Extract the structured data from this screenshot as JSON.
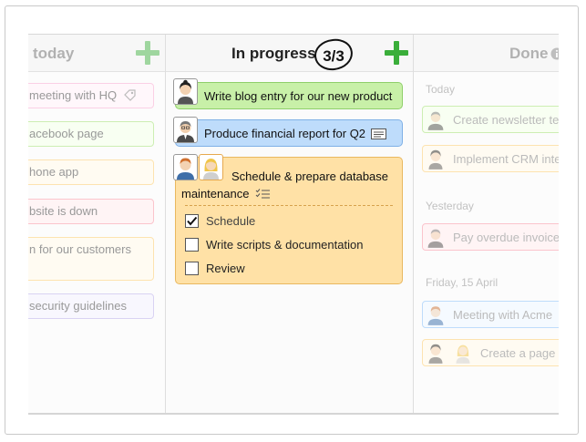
{
  "columns": {
    "left": {
      "title": "today",
      "cards": [
        {
          "text": "meeting with HQ",
          "color": "#fbd0e5"
        },
        {
          "text": "acebook page",
          "color": "#cdeeb3"
        },
        {
          "text": "hone app",
          "color": "#fde3b0"
        },
        {
          "text": "bsite is down",
          "color": "#fbc4cc"
        },
        {
          "text": "n for our customers",
          "color": "#fde3b0"
        },
        {
          "text": "security guidelines",
          "color": "#d9d3f3"
        }
      ]
    },
    "middle": {
      "title": "In progress",
      "count": "3/3",
      "cards": [
        {
          "text": "Write blog entry for our new product",
          "color": "#c8f0a8"
        },
        {
          "text": "Produce financial report for Q2",
          "color": "#bedcfb"
        },
        {
          "text_line1": "Schedule & prepare database",
          "text_line2": "maintenance",
          "color": "#ffe1a6"
        }
      ],
      "checklist": [
        {
          "label": "Schedule",
          "checked": true
        },
        {
          "label": "Write scripts & documentation",
          "checked": false
        },
        {
          "label": "Review",
          "checked": false
        }
      ]
    },
    "right": {
      "title": "Done",
      "sections": [
        {
          "label": "Today",
          "cards": [
            "Create newsletter te",
            "Implement CRM inte"
          ]
        },
        {
          "label": "Yesterday",
          "cards": [
            "Pay overdue invoice"
          ]
        },
        {
          "label": "Friday, 15 April",
          "cards": [
            "Meeting with Acme",
            "Create a page o"
          ]
        }
      ]
    }
  },
  "icons": {
    "add": "plus-icon",
    "tag": "tag-icon",
    "note": "note-icon",
    "checklist": "checklist-icon",
    "info": "info-icon"
  }
}
